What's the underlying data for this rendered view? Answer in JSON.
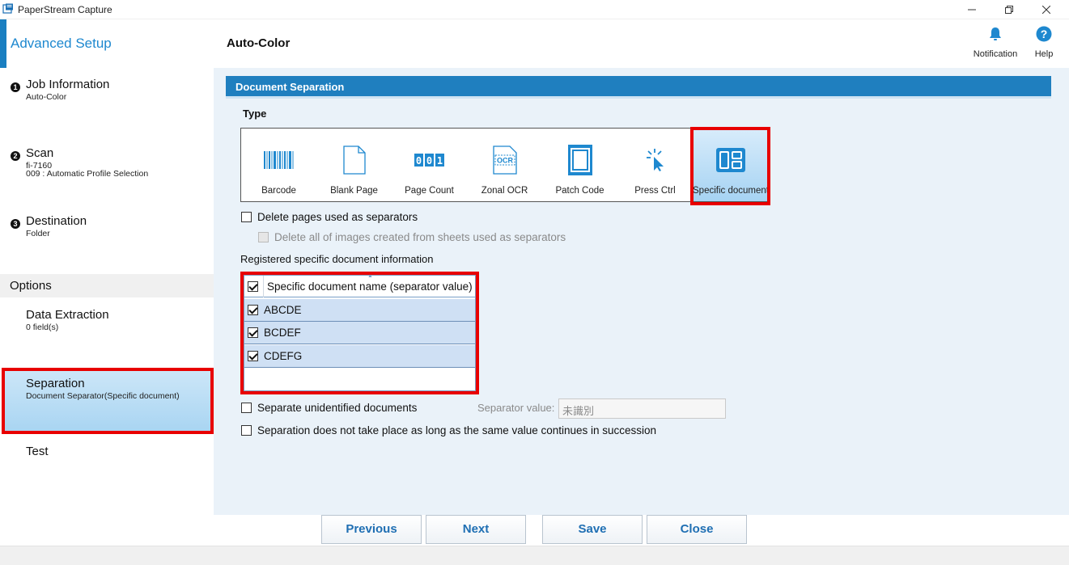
{
  "window": {
    "title": "PaperStream Capture"
  },
  "sidebar": {
    "heading": "Advanced Setup",
    "steps": [
      {
        "num": "1",
        "label": "Job Information",
        "sub": "Auto-Color"
      },
      {
        "num": "2",
        "label": "Scan",
        "sub1": "fi-7160",
        "sub2": "009 : Automatic Profile Selection"
      },
      {
        "num": "3",
        "label": "Destination",
        "sub": "Folder"
      }
    ],
    "options_label": "Options",
    "options": [
      {
        "label": "Data Extraction",
        "sub": "0 field(s)"
      },
      {
        "label": "Separation",
        "sub": "Document Separator(Specific document)",
        "selected": true
      },
      {
        "label": "Test",
        "sub": ""
      }
    ]
  },
  "header": {
    "page_title": "Auto-Color",
    "notification_label": "Notification",
    "help_label": "Help"
  },
  "section": {
    "title": "Document Separation",
    "type_label": "Type",
    "types": [
      {
        "label": "Barcode",
        "icon": "barcode-icon"
      },
      {
        "label": "Blank Page",
        "icon": "blank-page-icon"
      },
      {
        "label": "Page Count",
        "icon": "page-count-icon",
        "digits": "001"
      },
      {
        "label": "Zonal OCR",
        "icon": "zonal-ocr-icon",
        "text": "OCR"
      },
      {
        "label": "Patch Code",
        "icon": "patch-code-icon"
      },
      {
        "label": "Press Ctrl",
        "icon": "press-ctrl-icon"
      },
      {
        "label": "Specific document",
        "icon": "specific-document-icon",
        "selected": true
      }
    ],
    "delete_pages_label": "Delete pages used as separators",
    "delete_pages_checked": false,
    "delete_images_label": "Delete all of images created from sheets used as separators",
    "delete_images_checked": false,
    "registered_label": "Registered specific document information",
    "grid": {
      "header": "Specific document name (separator value)",
      "header_checked": true,
      "rows": [
        {
          "name": "ABCDE",
          "checked": true
        },
        {
          "name": "BCDEF",
          "checked": true
        },
        {
          "name": "CDEFG",
          "checked": true
        }
      ]
    },
    "separate_unidentified_label": "Separate unidentified documents",
    "separate_unidentified_checked": false,
    "separator_value_label": "Separator value:",
    "separator_value": "未識別",
    "no_separation_label": "Separation does not take place as long as the same value continues in succession",
    "no_separation_checked": false
  },
  "footer": {
    "previous": "Previous",
    "next": "Next",
    "save": "Save",
    "close": "Close"
  },
  "colors": {
    "accent": "#1f7fbf",
    "highlight": "#e80000",
    "selection": "#a9d5f2"
  }
}
